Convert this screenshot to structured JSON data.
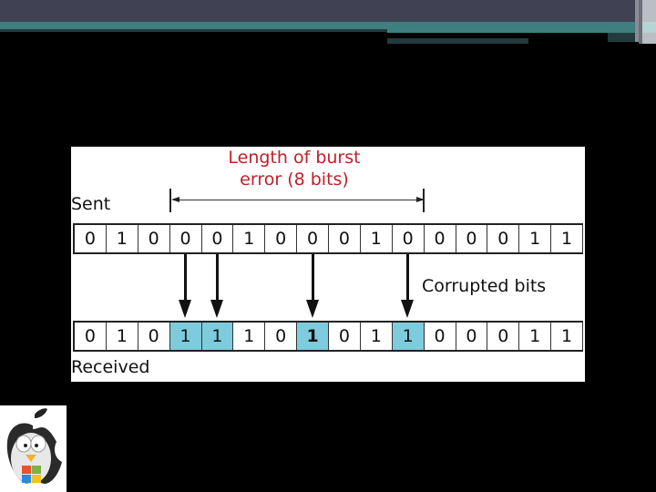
{
  "slide": {
    "colors": {
      "top_bar": "#404254",
      "accent_teal": "#3f7f80",
      "background": "#000000",
      "burst_label": "#c0202a",
      "highlight": "#7ecbde"
    }
  },
  "diagram": {
    "title_line1": "Length of burst",
    "title_line2": "error (8 bits)",
    "sent_label": "Sent",
    "received_label": "Received",
    "corrupted_label": "Corrupted bits",
    "burst_length_bits": 8,
    "sent_bits": [
      "0",
      "1",
      "0",
      "0",
      "0",
      "1",
      "0",
      "0",
      "0",
      "1",
      "0",
      "0",
      "0",
      "0",
      "1",
      "1"
    ],
    "received_bits": [
      "0",
      "1",
      "0",
      "1",
      "1",
      "1",
      "0",
      "1",
      "0",
      "1",
      "1",
      "0",
      "0",
      "0",
      "1",
      "1"
    ],
    "corrupted_indices": [
      3,
      4,
      7,
      10
    ],
    "burst_start_index": 3,
    "burst_end_index": 10
  },
  "logo": {
    "icon": "apple-penguin-windows-logo-icon"
  }
}
